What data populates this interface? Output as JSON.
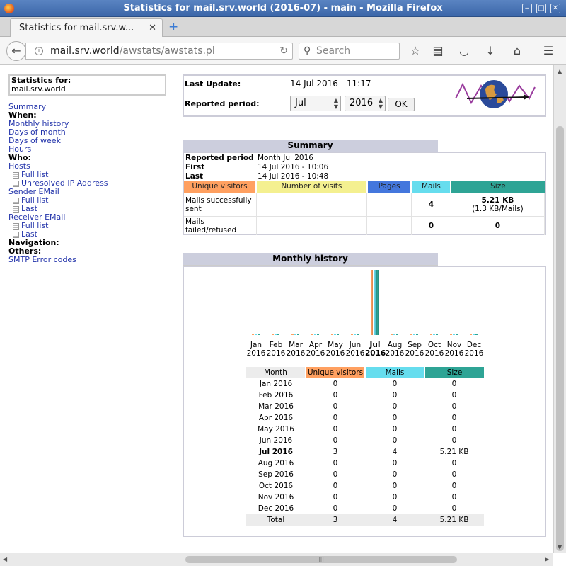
{
  "window": {
    "title": "Statistics for mail.srv.world (2016-07) - main - Mozilla Firefox"
  },
  "tab": {
    "title": "Statistics for mail.srv.w...",
    "close": "✕",
    "new": "+"
  },
  "nav": {
    "url_host": "mail.srv.world",
    "url_path": "/awstats/awstats.pl",
    "search_placeholder": "Search"
  },
  "menu": {
    "stat_for_label": "Statistics for:",
    "stat_for_value": "mail.srv.world",
    "summary": "Summary",
    "when": "When:",
    "monthly": "Monthly history",
    "days_month": "Days of month",
    "days_week": "Days of week",
    "hours": "Hours",
    "who": "Who:",
    "hosts": "Hosts",
    "hosts_full": "Full list",
    "hosts_unres": "Unresolved IP Address",
    "sender": "Sender EMail",
    "sender_full": "Full list",
    "sender_last": "Last",
    "receiver": "Receiver EMail",
    "receiver_full": "Full list",
    "receiver_last": "Last",
    "navigation": "Navigation:",
    "others": "Others:",
    "smtp": "SMTP Error codes"
  },
  "top": {
    "last_update_label": "Last Update:",
    "last_update_value": "14 Jul 2016 - 11:17",
    "period_label": "Reported period:",
    "month": "Jul",
    "year": "2016",
    "ok": "OK"
  },
  "summary": {
    "title": "Summary",
    "reported_label": "Reported period",
    "reported_value": "Month Jul 2016",
    "first_label": "First",
    "first_value": "14 Jul 2016 - 10:06",
    "last_label": "Last",
    "last_value": "14 Jul 2016 - 10:48",
    "headers": [
      "Unique visitors",
      "Number of visits",
      "Pages",
      "Mails",
      "Size"
    ],
    "sent_label": "Mails successfully sent",
    "sent_mails": "4",
    "sent_size": "5.21 KB",
    "sent_size_sub": "(1.3 KB/Mails)",
    "failed_label": "Mails failed/refused",
    "failed_mails": "0",
    "failed_size": "0"
  },
  "colors": {
    "unique": "#ffa060",
    "visits": "#f4f090",
    "pages": "#4477dd",
    "mails": "#66ddee",
    "size": "#2ea495"
  },
  "monthly": {
    "title": "Monthly history",
    "headers": [
      "Month",
      "Unique visitors",
      "Mails",
      "Size"
    ],
    "rows": [
      {
        "month": "Jan 2016",
        "unique": "0",
        "mails": "0",
        "size": "0"
      },
      {
        "month": "Feb 2016",
        "unique": "0",
        "mails": "0",
        "size": "0"
      },
      {
        "month": "Mar 2016",
        "unique": "0",
        "mails": "0",
        "size": "0"
      },
      {
        "month": "Apr 2016",
        "unique": "0",
        "mails": "0",
        "size": "0"
      },
      {
        "month": "May 2016",
        "unique": "0",
        "mails": "0",
        "size": "0"
      },
      {
        "month": "Jun 2016",
        "unique": "0",
        "mails": "0",
        "size": "0"
      },
      {
        "month": "Jul 2016",
        "unique": "3",
        "mails": "4",
        "size": "5.21 KB"
      },
      {
        "month": "Aug 2016",
        "unique": "0",
        "mails": "0",
        "size": "0"
      },
      {
        "month": "Sep 2016",
        "unique": "0",
        "mails": "0",
        "size": "0"
      },
      {
        "month": "Oct 2016",
        "unique": "0",
        "mails": "0",
        "size": "0"
      },
      {
        "month": "Nov 2016",
        "unique": "0",
        "mails": "0",
        "size": "0"
      },
      {
        "month": "Dec 2016",
        "unique": "0",
        "mails": "0",
        "size": "0"
      }
    ],
    "total": {
      "label": "Total",
      "unique": "3",
      "mails": "4",
      "size": "5.21 KB"
    }
  },
  "chart_data": {
    "type": "bar",
    "categories": [
      "Jan",
      "Feb",
      "Mar",
      "Apr",
      "May",
      "Jun",
      "Jul",
      "Aug",
      "Sep",
      "Oct",
      "Nov",
      "Dec"
    ],
    "year": "2016",
    "series": [
      {
        "name": "Unique visitors",
        "values": [
          0,
          0,
          0,
          0,
          0,
          0,
          3,
          0,
          0,
          0,
          0,
          0
        ]
      },
      {
        "name": "Mails",
        "values": [
          0,
          0,
          0,
          0,
          0,
          0,
          4,
          0,
          0,
          0,
          0,
          0
        ]
      },
      {
        "name": "Size",
        "values": [
          0,
          0,
          0,
          0,
          0,
          0,
          5.21,
          0,
          0,
          0,
          0,
          0
        ]
      }
    ]
  }
}
